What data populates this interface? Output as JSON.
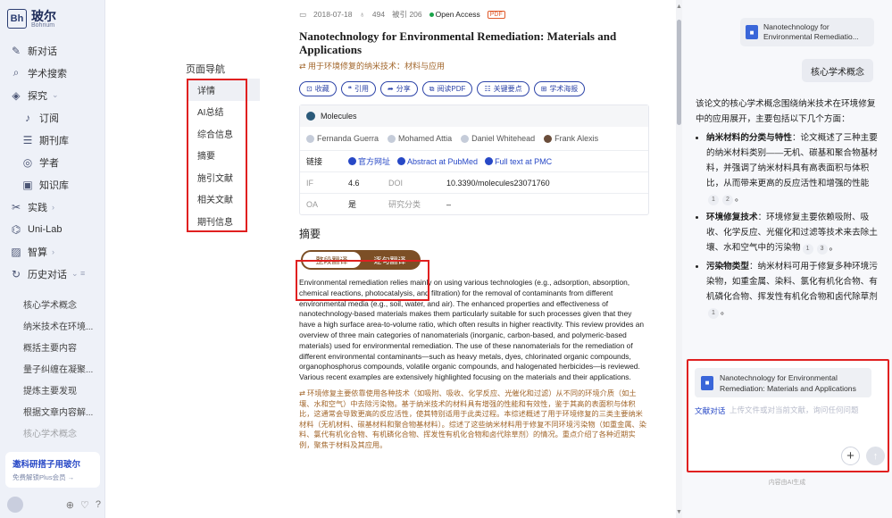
{
  "brand": {
    "name": "玻尔",
    "sub": "Bohrium",
    "mark": "Bh"
  },
  "sidebar": {
    "items": [
      {
        "label": "新对话",
        "icon": "edit-icon"
      },
      {
        "label": "学术搜索",
        "icon": "search-icon"
      },
      {
        "label": "探究",
        "icon": "explore-icon",
        "caret": "⌄"
      },
      {
        "label": "订阅",
        "icon": "bell-icon",
        "sub": true
      },
      {
        "label": "期刊库",
        "icon": "journal-icon",
        "sub": true
      },
      {
        "label": "学者",
        "icon": "scholar-icon",
        "sub": true
      },
      {
        "label": "知识库",
        "icon": "knowledge-icon",
        "sub": true
      },
      {
        "label": "实践",
        "icon": "practice-icon",
        "caret": "›"
      },
      {
        "label": "Uni-Lab",
        "icon": "lab-icon"
      },
      {
        "label": "智算",
        "icon": "compute-icon",
        "caret": "›"
      },
      {
        "label": "历史对话",
        "icon": "history-icon",
        "caret": "⌄  ≡"
      }
    ],
    "history": [
      "核心学术概念",
      "纳米技术在环境...",
      "概括主要内容",
      "量子纠缠在凝聚...",
      "提炼主要发现",
      "根据文章内容解...",
      "核心学术概念"
    ],
    "promo": {
      "title": "邀科研搭子用玻尔",
      "sub": "免费解锁Plus会员 →"
    }
  },
  "toc": {
    "title": "页面导航",
    "items": [
      "详情",
      "AI总结",
      "综合信息",
      "摘要",
      "施引文献",
      "相关文献",
      "期刊信息"
    ]
  },
  "paper": {
    "date": "2018-07-18",
    "likes": "494",
    "cited": "被引 206",
    "oa": "Open Access",
    "pdf": "PDF",
    "title": "Nanotechnology for Environmental Remediation: Materials and Applications",
    "subtitle": "用于环境修复的纳米技术：材料与应用",
    "actions": [
      "收藏",
      "引用",
      "分享",
      "阅读PDF",
      "关键要点",
      "学术海报"
    ],
    "journal": "Molecules",
    "authors": [
      "Fernanda Guerra",
      "Mohamed Attia",
      "Daniel Whitehead",
      "Frank Alexis"
    ],
    "links_label": "链接",
    "links": [
      "官方网址",
      "Abstract at PubMed",
      "Full text at PMC"
    ],
    "if_label": "IF",
    "if_value": "4.6",
    "doi_label": "DOI",
    "doi_value": "10.3390/molecules23071760",
    "oa_label": "OA",
    "oa_value": "是",
    "category_label": "研究分类",
    "category_value": "–",
    "abstract_heading": "摘要",
    "toggle": [
      "整段翻译",
      "逐句翻译"
    ],
    "abstract": "Environmental remediation relies mainly on using various technologies (e.g., adsorption, absorption, chemical reactions, photocatalysis, and filtration) for the removal of contaminants from different environmental media (e.g., soil, water, and air). The enhanced properties and effectiveness of nanotechnology-based materials makes them particularly suitable for such processes given that they have a high surface area-to-volume ratio, which often results in higher reactivity. This review provides an overview of three main categories of nanomaterials (inorganic, carbon-based, and polymeric-based materials) used for environmental remediation. The use of these nanomaterials for the remediation of different environmental contaminants—such as heavy metals, dyes, chlorinated organic compounds, organophosphorus compounds, volatile organic compounds, and halogenated herbicides—is reviewed. Various recent examples are extensively highlighted focusing on the materials and their applications.",
    "translation": "环境修复主要依靠使用各种技术（如吸附、吸收、化学反应、光催化和过滤）从不同的环境介质（如土壤、水和空气）中去除污染物。基于纳米技术的材料具有增强的性能和有效性，鉴于其高的表面积与体积比，这通常会导致更高的反应活性，使其特别适用于此类过程。本综述概述了用于环境修复的三类主要纳米材料（无机材料、碳基材料和聚合物基材料）。综述了这些纳米材料用于修复不同环境污染物（如重金属、染料、氯代有机化合物、有机磷化合物、挥发性有机化合物和卤代除草剂）的情况。重点介绍了各种近期实例，聚焦于材料及其应用。"
  },
  "chat": {
    "doc_chip": "Nanotechnology for Environmental Remediatio...",
    "question": "核心学术概念",
    "intro": "该论文的核心学术概念围绕纳米技术在环境修复中的应用展开，主要包括以下几个方面：",
    "points": [
      {
        "head": "纳米材料的分类与特性",
        "body": "：论文概述了三种主要的纳米材料类别——无机、碳基和聚合物基材料，并强调了纳米材料具有高表面积与体积比，从而带来更高的反应活性和增强的性能",
        "cites": [
          "1",
          "2"
        ],
        "tail": "。"
      },
      {
        "head": "环境修复技术",
        "body": "：环境修复主要依赖吸附、吸收、化学反应、光催化和过滤等技术来去除土壤、水和空气中的污染物",
        "cites": [
          "1",
          "3"
        ],
        "tail": "。"
      },
      {
        "head": "污染物类型",
        "body": "：纳米材料可用于修复多种环境污染物，如重金属、染料、氯化有机化合物、有机磷化合物、挥发性有机化合物和卤代除草剂",
        "cites": [
          "1"
        ],
        "tail": "。"
      }
    ],
    "input_chip": "Nanotechnology for Environmental Remediation: Materials and Applications",
    "input_label": "文献对话",
    "input_placeholder": "上传文件或对当前文献，询问任何问题",
    "disclaimer": "内容由AI生成"
  }
}
